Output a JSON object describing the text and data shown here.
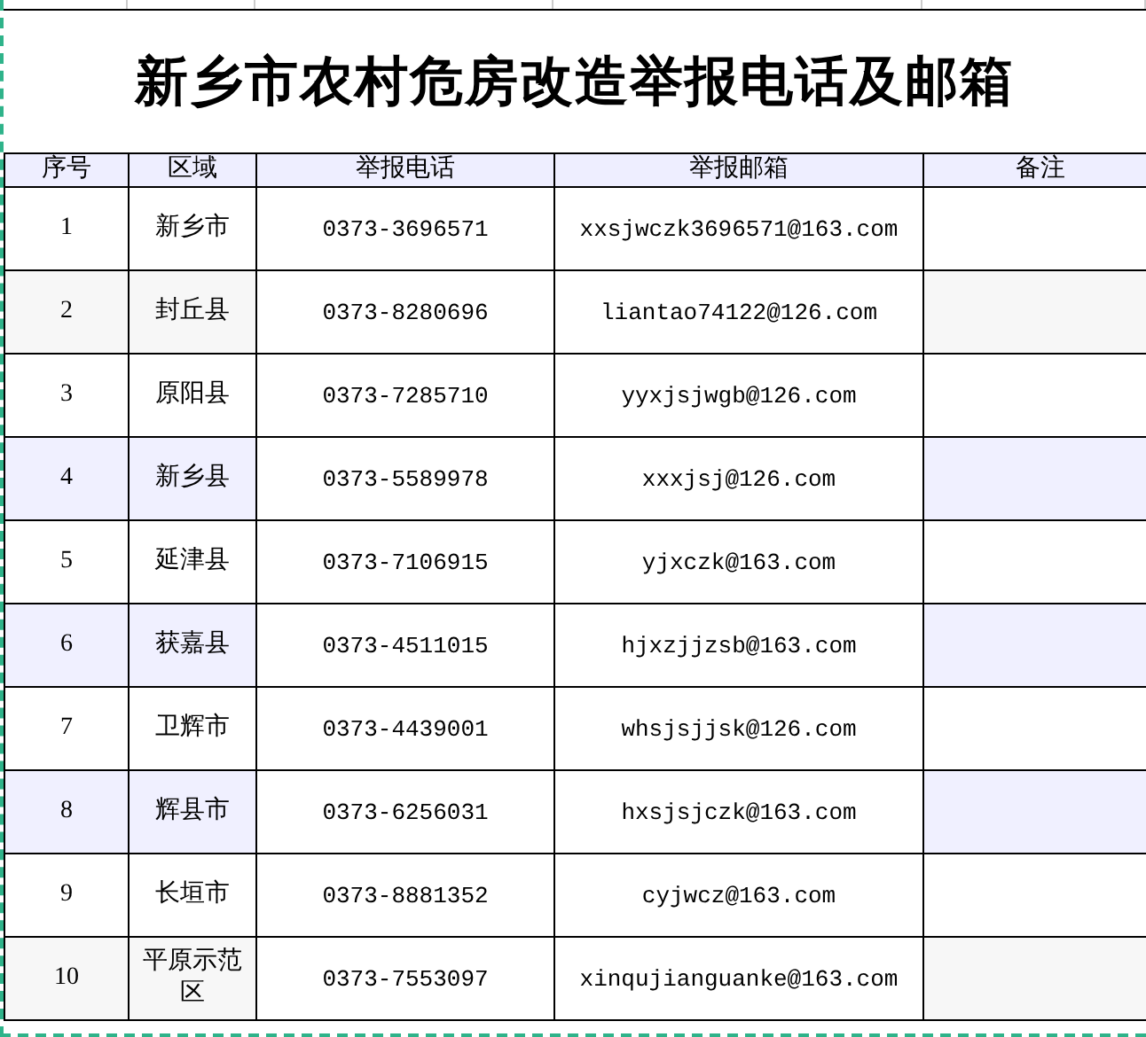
{
  "title": "新乡市农村危房改造举报电话及邮箱",
  "columns": [
    "序号",
    "区域",
    "举报电话",
    "举报邮箱",
    "备注"
  ],
  "rows": [
    {
      "no": "1",
      "area": "新乡市",
      "phone": "0373-3696571",
      "email": "xxsjwczk3696571@163.com",
      "color": "#ffffff"
    },
    {
      "no": "2",
      "area": "封丘县",
      "phone": "0373-8280696",
      "email": "liantao74122@126.com",
      "color": "#f7f7f7"
    },
    {
      "no": "3",
      "area": "原阳县",
      "phone": "0373-7285710",
      "email": "yyxjsjwgb@126.com",
      "color": "#ffffff"
    },
    {
      "no": "4",
      "area": "新乡县",
      "phone": "0373-5589978",
      "email": "xxxjsj@126.com",
      "color": "#f0f0ff"
    },
    {
      "no": "5",
      "area": "延津县",
      "phone": "0373-7106915",
      "email": "yjxczk@163.com",
      "color": "#ffffff"
    },
    {
      "no": "6",
      "area": "获嘉县",
      "phone": "0373-4511015",
      "email": "hjxzjjzsb@163.com",
      "color": "#f0f0ff"
    },
    {
      "no": "7",
      "area": "卫辉市",
      "phone": "0373-4439001",
      "email": "whsjsjjsk@126.com",
      "color": "#ffffff"
    },
    {
      "no": "8",
      "area": "辉县市",
      "phone": "0373-6256031",
      "email": "hxsjsjczk@163.com",
      "color": "#f0f0ff"
    },
    {
      "no": "9",
      "area": "长垣市",
      "phone": "0373-8881352",
      "email": "cyjwcz@163.com",
      "color": "#ffffff"
    },
    {
      "no": "10",
      "area": "平原示范区",
      "phone": "0373-7553097",
      "email": "xinqujianguanke@163.com",
      "color": "#f7f7f7"
    }
  ]
}
